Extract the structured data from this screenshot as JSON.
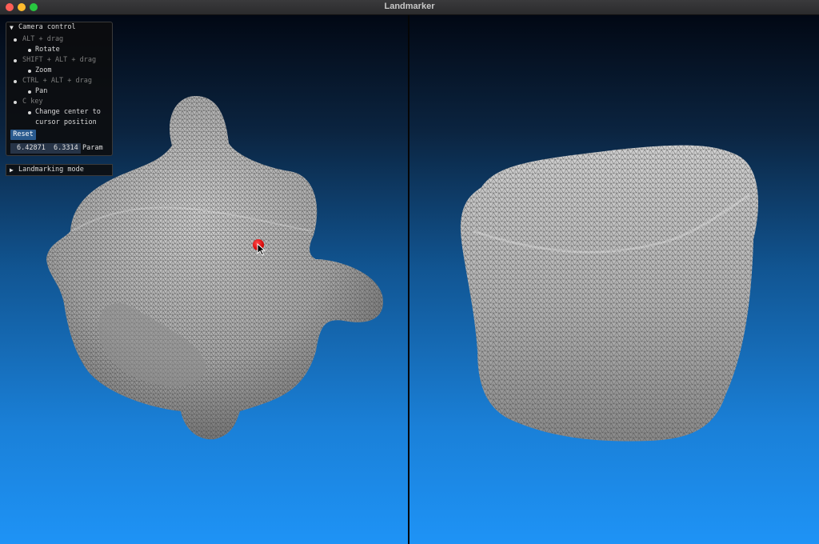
{
  "window": {
    "title": "Landmarker"
  },
  "camera_panel": {
    "header": "Camera control",
    "items": [
      {
        "key": "ALT + drag",
        "action": "Rotate"
      },
      {
        "key": "SHIFT + ALT + drag",
        "action": "Zoom"
      },
      {
        "key": "CTRL + ALT + drag",
        "action": "Pan"
      },
      {
        "key": "C key",
        "action_line1": "Change center to",
        "action_line2": "cursor position"
      }
    ],
    "reset_label": "Reset",
    "param_value_1": "6.42871",
    "param_value_2": "6.3314",
    "param_label": "Param"
  },
  "landmarking_panel": {
    "header": "Landmarking mode"
  },
  "colors": {
    "marker": "#d00000",
    "background_top": "#020814",
    "background_bottom": "#1e93f6",
    "mesh_fill": "#b3b3b3"
  },
  "icons": {
    "collapse": "triangle-down-icon",
    "expand": "triangle-right-icon"
  }
}
